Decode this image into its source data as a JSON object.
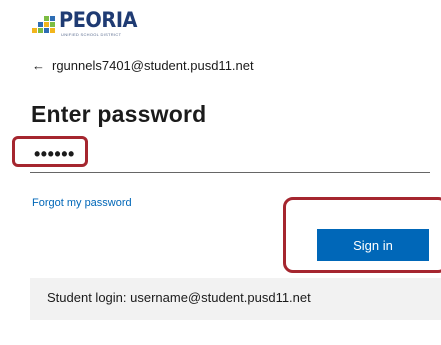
{
  "brand": {
    "name": "PEORIA",
    "tagline": "UNIFIED SCHOOL DISTRICT",
    "colors": {
      "navy": "#1f3b73",
      "green": "#7cbc42",
      "blue": "#2e6db4",
      "yellow": "#f2b51c"
    }
  },
  "identity": {
    "back_icon": "←",
    "account": "rgunnels7401@student.pusd11.net"
  },
  "heading": "Enter password",
  "password": {
    "masked_value": "••••••"
  },
  "links": {
    "forgot": "Forgot my password"
  },
  "actions": {
    "sign_in": "Sign in"
  },
  "hint": {
    "text": "Student login: username@student.pusd11.net"
  },
  "colors": {
    "primary": "#0067b8",
    "highlight": "#a5262f",
    "hint_bg": "#f2f2f2"
  }
}
